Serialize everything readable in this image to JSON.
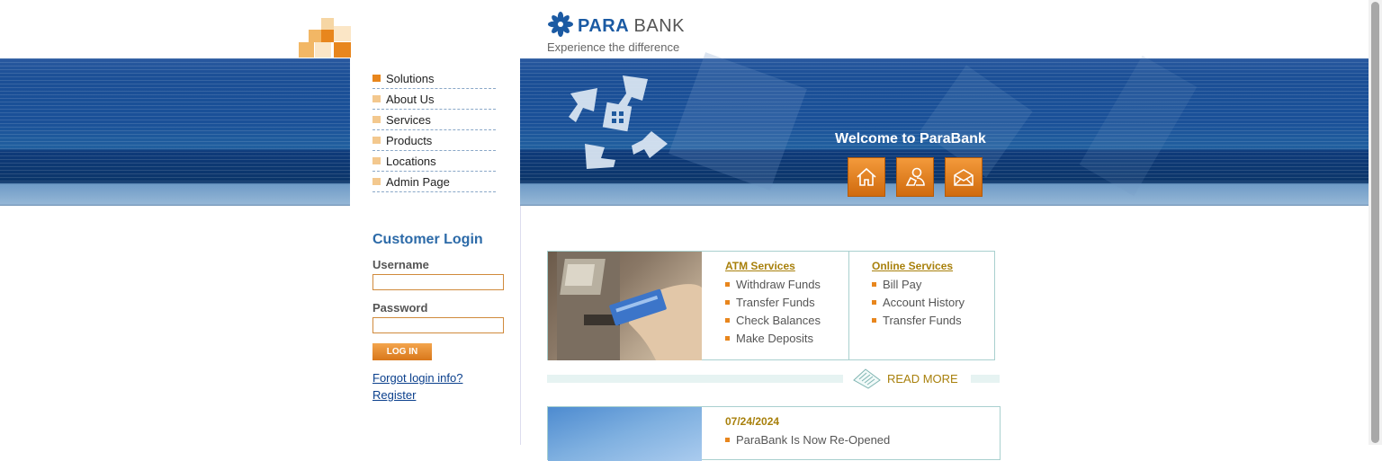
{
  "header": {
    "logo_para": "PARA",
    "logo_bank": "BANK",
    "tagline": "Experience the difference"
  },
  "colors": {
    "brand_blue": "#1b5aa3",
    "accent_orange": "#e8861d",
    "gold_link": "#a8800c"
  },
  "menu": {
    "items": [
      {
        "label": "Solutions",
        "active": true
      },
      {
        "label": "About Us"
      },
      {
        "label": "Services"
      },
      {
        "label": "Products"
      },
      {
        "label": "Locations"
      },
      {
        "label": "Admin Page"
      }
    ]
  },
  "banner": {
    "welcome": "Welcome to ParaBank",
    "icons": [
      "home-icon",
      "about-icon",
      "contact-icon"
    ]
  },
  "login": {
    "title": "Customer Login",
    "username_label": "Username",
    "username_value": "",
    "password_label": "Password",
    "password_value": "",
    "button": "LOG IN",
    "forgot": "Forgot login info?",
    "register": "Register"
  },
  "services": {
    "atm": {
      "title": "ATM Services",
      "items": [
        "Withdraw Funds",
        "Transfer Funds",
        "Check Balances",
        "Make Deposits"
      ]
    },
    "online": {
      "title": "Online Services",
      "items": [
        "Bill Pay",
        "Account History",
        "Transfer Funds"
      ]
    },
    "read_more": "READ MORE"
  },
  "news": {
    "date": "07/24/2024",
    "items": [
      "ParaBank Is Now Re-Opened"
    ]
  }
}
